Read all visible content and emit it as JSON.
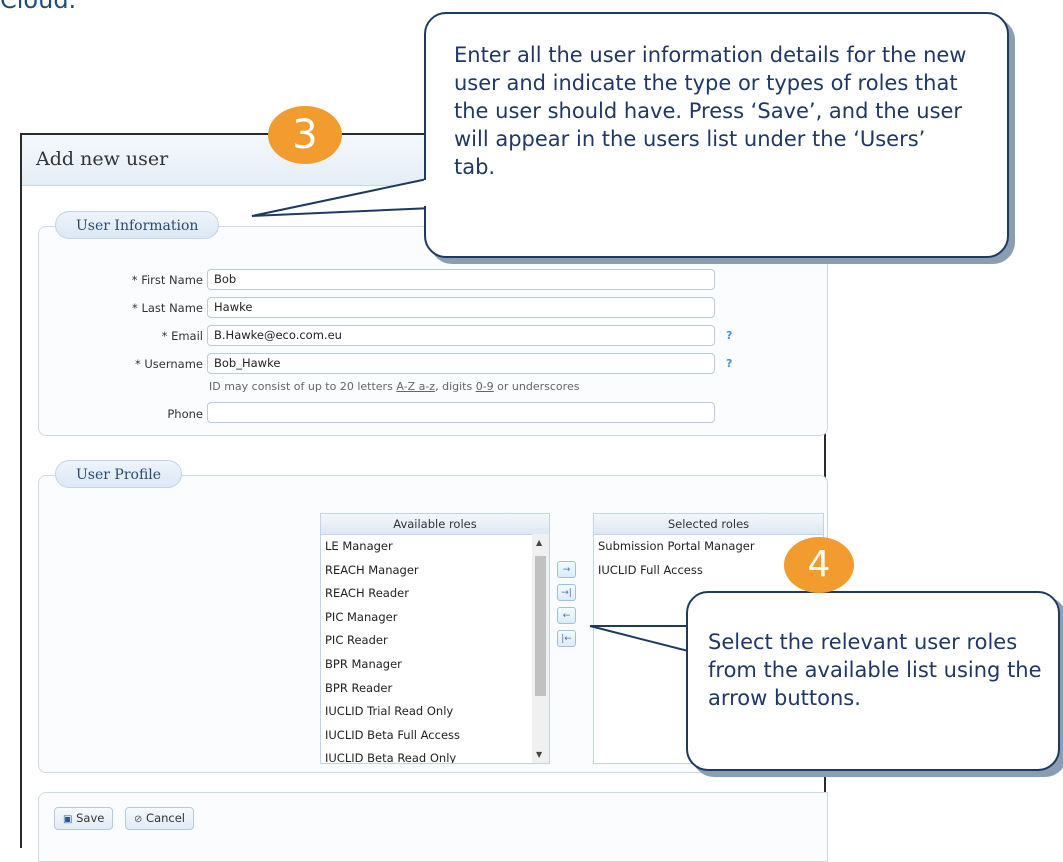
{
  "page_top_text": "Cloud.",
  "dialog": {
    "title": "Add new user",
    "user_information": {
      "legend": "User Information",
      "first_name_label": "* First Name",
      "first_name_value": "Bob",
      "last_name_label": "* Last Name",
      "last_name_value": "Hawke",
      "email_label": "* Email",
      "email_value": "B.Hawke@eco.com.eu",
      "username_label": "* Username",
      "username_value": "Bob_Hawke",
      "help_mark": "?",
      "username_hint": {
        "prefix": "ID may consist of up to 20 letters ",
        "letters": "A-Z a-z",
        "middle": ", digits ",
        "digits": "0-9",
        "suffix": " or underscores"
      },
      "phone_label": "Phone",
      "phone_value": ""
    },
    "user_profile": {
      "legend": "User Profile",
      "available_header": "Available roles",
      "available_roles": [
        "LE Manager",
        "REACH Manager",
        "REACH Reader",
        "PIC Manager",
        "PIC Reader",
        "BPR Manager",
        "BPR Reader",
        "IUCLID Trial Read Only",
        "IUCLID Beta Full Access",
        "IUCLID Beta Read Only"
      ],
      "selected_header": "Selected roles",
      "selected_roles": [
        "Submission Portal Manager",
        "IUCLID Full Access"
      ],
      "move_buttons": [
        "→",
        "→|",
        "←",
        "|←"
      ]
    },
    "actions": {
      "save_label": "Save",
      "cancel_label": "Cancel"
    }
  },
  "callouts": {
    "step3": {
      "badge": "3",
      "text": "Enter all the user information details for the new user and indicate the type or types of roles that the user should have. Press ‘Save’, and the user will appear in the users list under the ‘Users’ tab."
    },
    "step4": {
      "badge": "4",
      "text": "Select the relevant user roles from the available list using the arrow buttons."
    }
  },
  "colors": {
    "callout_border": "#1e3a5f",
    "callout_text": "#1f3864",
    "badge": "#f29b2f",
    "accent": "#4a90c8"
  }
}
